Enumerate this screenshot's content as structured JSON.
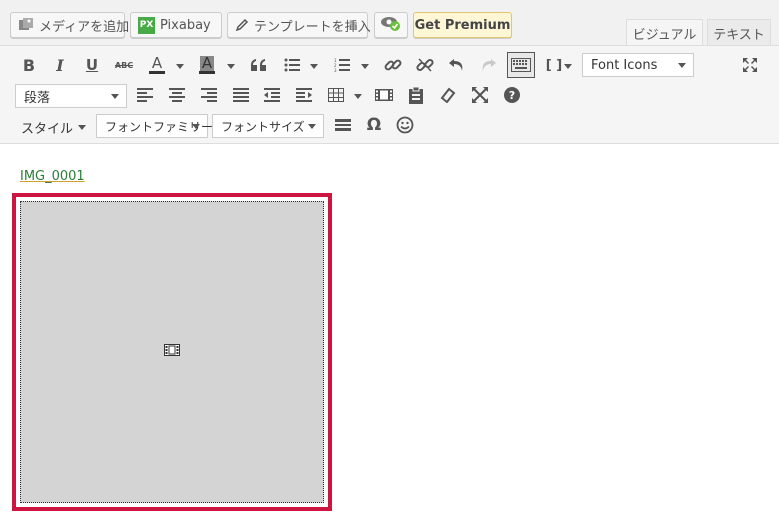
{
  "media_buttons": {
    "add_media": "メディアを追加",
    "pixabay": "Pixabay",
    "pixabay_logo": "PX",
    "insert_template": "テンプレートを挿入",
    "get_premium": "Get Premium"
  },
  "tabs": {
    "visual": "ビジュアル",
    "text": "テキスト",
    "active": "visual"
  },
  "toolbar": {
    "bold": "B",
    "italic": "I",
    "underline": "U",
    "strikethrough": "ABC",
    "text_color": "A",
    "background_color": "A",
    "shortcode": "[ ]",
    "font_icons": "Font Icons",
    "format_select": "段落",
    "style_menu": "スタイル",
    "font_family": "フォントファミリー",
    "font_size": "フォントサイズ",
    "omega": "Ω"
  },
  "content": {
    "image_caption": "IMG_0001"
  },
  "colors": {
    "selection_border": "#cc1541",
    "link_green": "#2c7d3a",
    "toolbar_bg": "#f5f5f5"
  }
}
